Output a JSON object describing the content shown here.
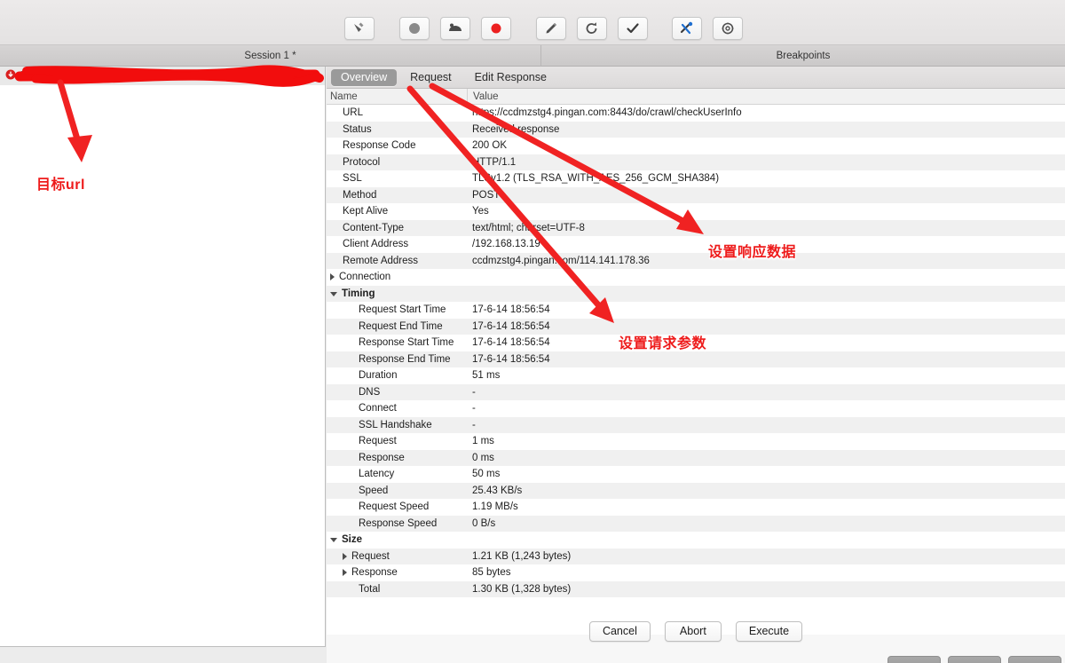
{
  "toolbar": {
    "buttons": [
      {
        "name": "clear-icon",
        "label": "Clear"
      },
      {
        "name": "record-stop-icon",
        "label": "Stop Recording"
      },
      {
        "name": "throttle-icon",
        "label": "Throttle"
      },
      {
        "name": "record-icon",
        "label": "Record"
      },
      {
        "name": "breakpoint-pen-icon",
        "label": "Breakpoints"
      },
      {
        "name": "repeat-icon",
        "label": "Repeat"
      },
      {
        "name": "checkmark-icon",
        "label": "Validate"
      },
      {
        "name": "tools-icon",
        "label": "Tools"
      },
      {
        "name": "settings-gear-icon",
        "label": "Settings"
      }
    ]
  },
  "tabstrip": {
    "session_tab": "Session 1 *",
    "breakpoints_tab": "Breakpoints"
  },
  "left_panel": {
    "entry_url": "https://",
    "entry_url_tail": "checkUserInfo",
    "breakpoint_icon": "breakpoint-stop-icon"
  },
  "detail": {
    "tabs": [
      {
        "label": "Overview",
        "active": true
      },
      {
        "label": "Request",
        "active": false
      },
      {
        "label": "Edit Response",
        "active": false
      }
    ],
    "columns": {
      "name": "Name",
      "value": "Value"
    },
    "rows": [
      {
        "indent": 1,
        "disclosure": "",
        "name": "URL",
        "value": "https://ccdmzstg4.pingan.com:8443/do/crawl/checkUserInfo"
      },
      {
        "indent": 1,
        "disclosure": "",
        "name": "Status",
        "value": "Received response"
      },
      {
        "indent": 1,
        "disclosure": "",
        "name": "Response Code",
        "value": "200 OK"
      },
      {
        "indent": 1,
        "disclosure": "",
        "name": "Protocol",
        "value": "HTTP/1.1"
      },
      {
        "indent": 1,
        "disclosure": "",
        "name": "SSL",
        "value": "TLSv1.2 (TLS_RSA_WITH_AES_256_GCM_SHA384)"
      },
      {
        "indent": 1,
        "disclosure": "",
        "name": "Method",
        "value": "POST"
      },
      {
        "indent": 1,
        "disclosure": "",
        "name": "Kept Alive",
        "value": "Yes"
      },
      {
        "indent": 1,
        "disclosure": "",
        "name": "Content-Type",
        "value": "text/html; charset=UTF-8"
      },
      {
        "indent": 1,
        "disclosure": "",
        "name": "Client Address",
        "value": "/192.168.13.19"
      },
      {
        "indent": 1,
        "disclosure": "",
        "name": "Remote Address",
        "value": "ccdmzstg4.pingan.com/114.141.178.36"
      },
      {
        "indent": 0,
        "disclosure": "closed",
        "name": "Connection",
        "value": ""
      },
      {
        "indent": 0,
        "disclosure": "open",
        "name": "Timing",
        "value": "",
        "group": true
      },
      {
        "indent": 2,
        "disclosure": "",
        "name": "Request Start Time",
        "value": "17-6-14 18:56:54"
      },
      {
        "indent": 2,
        "disclosure": "",
        "name": "Request End Time",
        "value": "17-6-14 18:56:54"
      },
      {
        "indent": 2,
        "disclosure": "",
        "name": "Response Start Time",
        "value": "17-6-14 18:56:54"
      },
      {
        "indent": 2,
        "disclosure": "",
        "name": "Response End Time",
        "value": "17-6-14 18:56:54"
      },
      {
        "indent": 2,
        "disclosure": "",
        "name": "Duration",
        "value": "51 ms"
      },
      {
        "indent": 2,
        "disclosure": "",
        "name": "DNS",
        "value": "-"
      },
      {
        "indent": 2,
        "disclosure": "",
        "name": "Connect",
        "value": "-"
      },
      {
        "indent": 2,
        "disclosure": "",
        "name": "SSL Handshake",
        "value": "-"
      },
      {
        "indent": 2,
        "disclosure": "",
        "name": "Request",
        "value": "1 ms"
      },
      {
        "indent": 2,
        "disclosure": "",
        "name": "Response",
        "value": "0 ms"
      },
      {
        "indent": 2,
        "disclosure": "",
        "name": "Latency",
        "value": "50 ms"
      },
      {
        "indent": 2,
        "disclosure": "",
        "name": "Speed",
        "value": "25.43 KB/s"
      },
      {
        "indent": 2,
        "disclosure": "",
        "name": "Request Speed",
        "value": "1.19 MB/s"
      },
      {
        "indent": 2,
        "disclosure": "",
        "name": "Response Speed",
        "value": "0 B/s"
      },
      {
        "indent": 0,
        "disclosure": "open",
        "name": "Size",
        "value": "",
        "group": true
      },
      {
        "indent": 1,
        "disclosure": "closed",
        "name": "Request",
        "value": "1.21 KB (1,243 bytes)"
      },
      {
        "indent": 1,
        "disclosure": "closed",
        "name": "Response",
        "value": "85 bytes"
      },
      {
        "indent": 2,
        "disclosure": "",
        "name": "Total",
        "value": "1.30 KB (1,328 bytes)"
      }
    ]
  },
  "dialog_buttons": [
    {
      "label": "Cancel",
      "name": "cancel-button"
    },
    {
      "label": "Abort",
      "name": "abort-button"
    },
    {
      "label": "Execute",
      "name": "execute-button"
    }
  ],
  "annotations": {
    "target_url": "目标url",
    "set_response_data": "设置响应数据",
    "set_request_params": "设置请求参数",
    "color": "#ee1b1b"
  }
}
